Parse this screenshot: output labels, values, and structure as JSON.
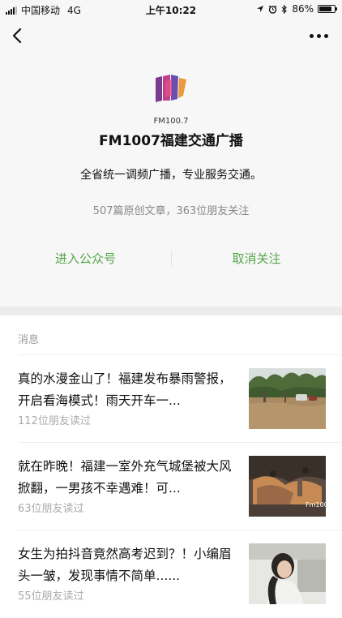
{
  "status_bar": {
    "carrier": "中国移动",
    "network": "4G",
    "time": "上午10:22",
    "battery": "86%",
    "battery_level": 0.86
  },
  "nav": {
    "back_icon": "chevron-left-icon",
    "more_icon": "more-dots-icon"
  },
  "account": {
    "logo_text": "FM100.7",
    "logo_subtext": "福建交通广播",
    "name": "FM1007福建交通广播",
    "description": "全省统一调频广播，专业服务交通。",
    "stats": "507篇原创文章，363位朋友关注",
    "enter_label": "进入公众号",
    "unfollow_label": "取消关注",
    "accent_color": "#55a64a"
  },
  "messages": {
    "section_title": "消息",
    "articles": [
      {
        "title": "真的水漫金山了！福建发布暴雨警报，开启看海模式！雨天开车一...",
        "reads": "112位朋友读过",
        "thumb": "flooded-street-image"
      },
      {
        "title": "就在昨晚！福建一室外充气城堡被大风掀翻，一男孩不幸遇难！可...",
        "reads": "63位朋友读过",
        "thumb": "collapsed-bouncy-castle-image",
        "thumb_watermark": "Fm100"
      },
      {
        "title": "女生为拍抖音竟然高考迟到？！小编眉头一皱，发现事情不简单......",
        "reads": "55位朋友读过",
        "thumb": "student-photo-image"
      }
    ]
  }
}
